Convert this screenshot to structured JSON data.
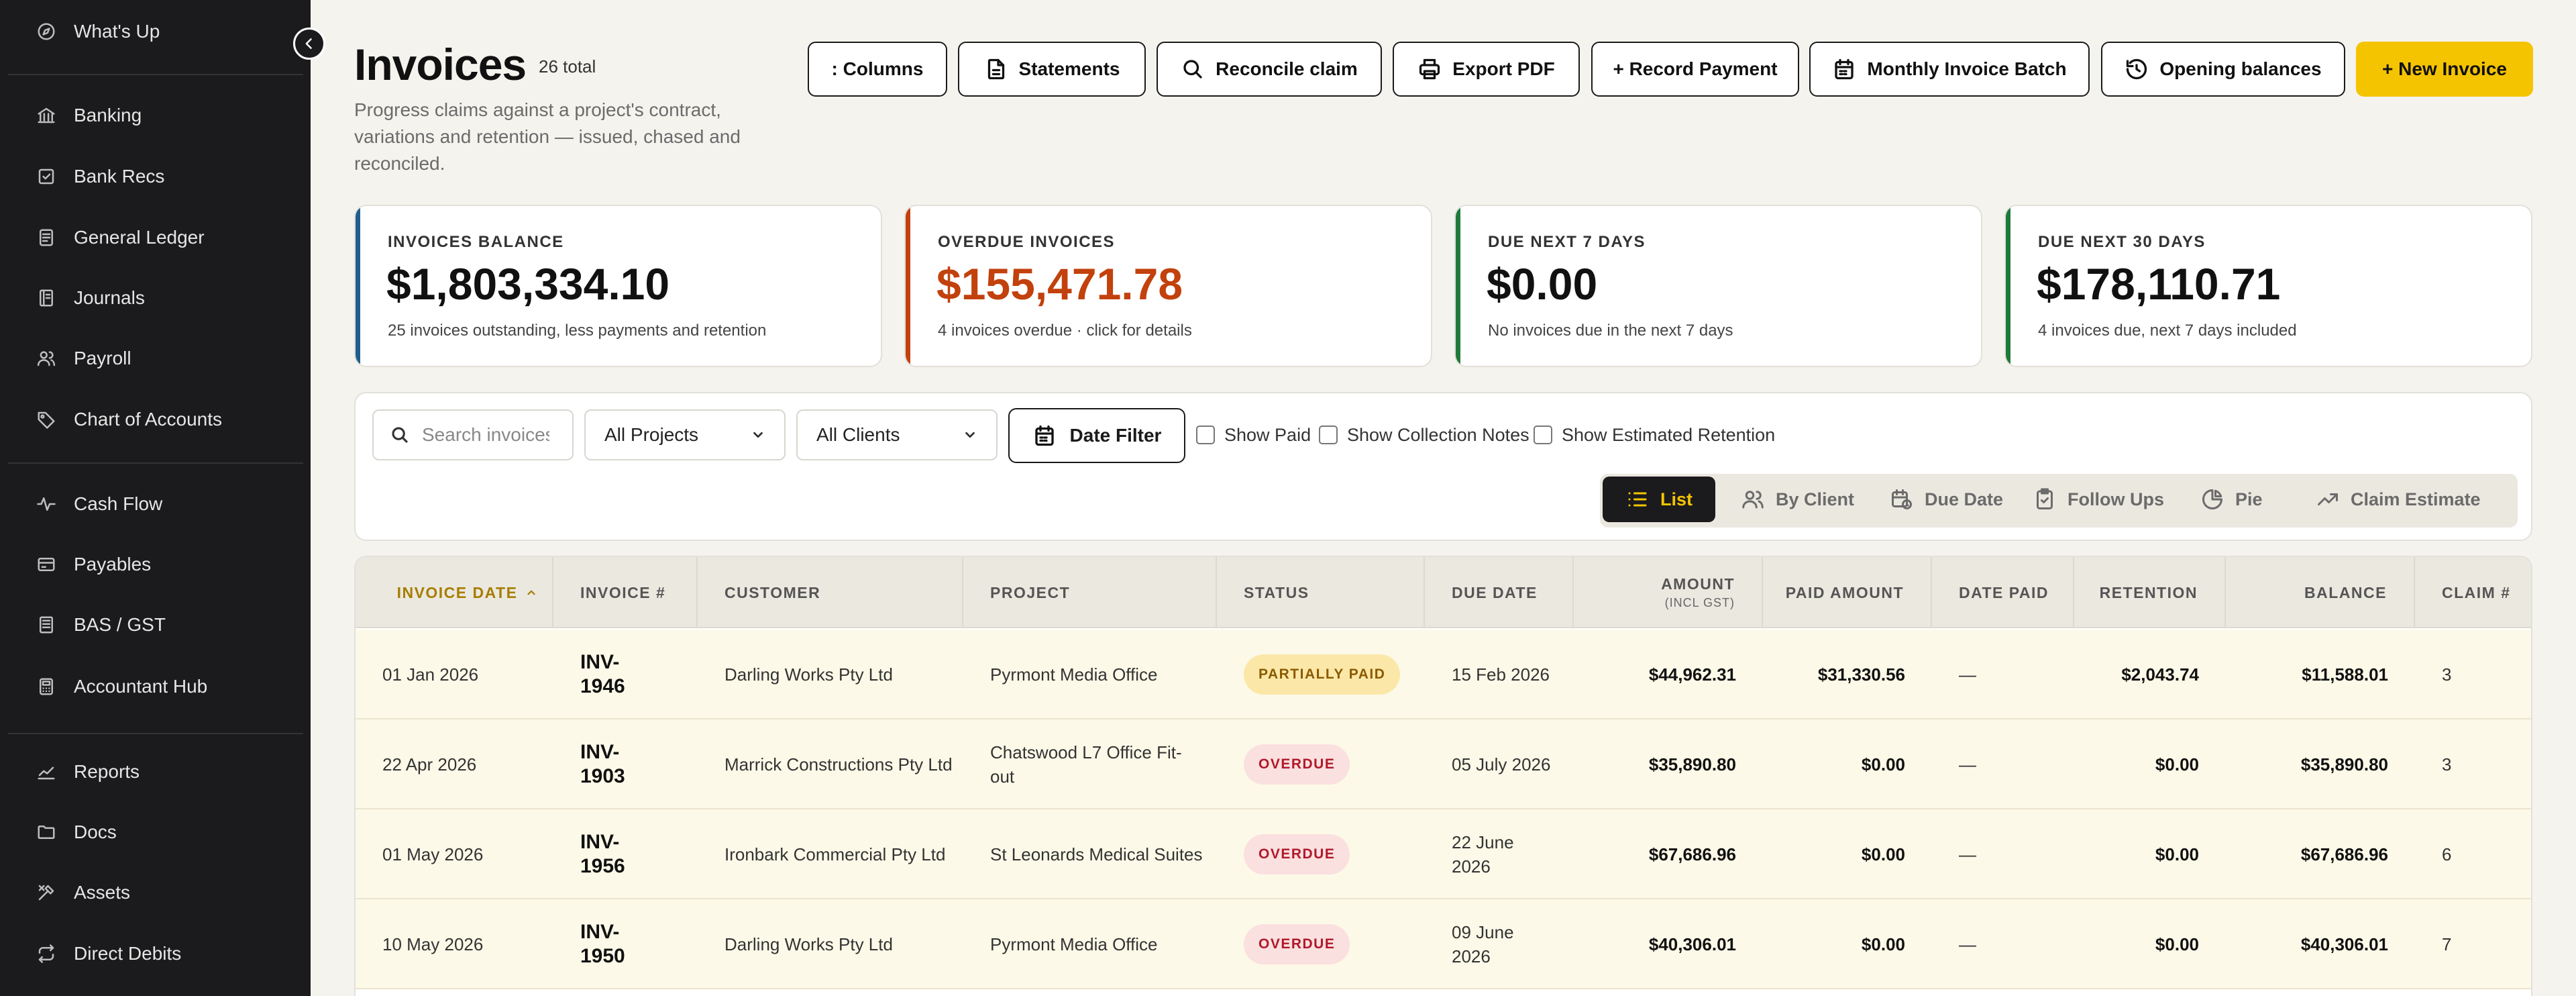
{
  "sidebar": {
    "items": [
      {
        "label": "What's Up",
        "icon": "compass-icon"
      },
      {
        "label": "Banking",
        "icon": "bank-icon"
      },
      {
        "label": "Bank Recs",
        "icon": "check-square-icon"
      },
      {
        "label": "General Ledger",
        "icon": "ledger-icon"
      },
      {
        "label": "Journals",
        "icon": "journal-icon"
      },
      {
        "label": "Payroll",
        "icon": "users-icon"
      },
      {
        "label": "Chart of Accounts",
        "icon": "tag-icon"
      },
      {
        "label": "Cash Flow",
        "icon": "pulse-icon"
      },
      {
        "label": "Payables",
        "icon": "card-icon"
      },
      {
        "label": "BAS / GST",
        "icon": "receipt-icon"
      },
      {
        "label": "Accountant Hub",
        "icon": "calculator-icon"
      },
      {
        "label": "Reports",
        "icon": "chart-icon"
      },
      {
        "label": "Docs",
        "icon": "folder-icon"
      },
      {
        "label": "Assets",
        "icon": "tools-icon"
      },
      {
        "label": "Direct Debits",
        "icon": "repeat-icon"
      }
    ]
  },
  "header": {
    "title": "Invoices",
    "total": "26 total",
    "subtitle": "Progress claims against a project's contract, variations and retention — issued, chased and reconciled."
  },
  "toolbar": {
    "columns": ": Columns",
    "statements": "Statements",
    "reconcile": "Reconcile claim",
    "export_pdf": "Export PDF",
    "record_payment": "+ Record Payment",
    "monthly_batch": "Monthly Invoice Batch",
    "opening_balances": "Opening balances",
    "new_invoice": "+ New Invoice"
  },
  "kpis": [
    {
      "label": "INVOICES BALANCE",
      "value": "$1,803,334.10",
      "note": "25 invoices outstanding, less payments and retention",
      "accent": "#1f5e8c",
      "value_color": "#111111"
    },
    {
      "label": "OVERDUE INVOICES",
      "value": "$155,471.78",
      "note": "4 invoices overdue · click for details",
      "accent": "#c2410c",
      "value_color": "#c2410c"
    },
    {
      "label": "DUE NEXT 7 DAYS",
      "value": "$0.00",
      "note": "No invoices due in the next 7 days",
      "accent": "#1f7a3a",
      "value_color": "#111111"
    },
    {
      "label": "DUE NEXT 30 DAYS",
      "value": "$178,110.71",
      "note": "4 invoices due, next 7 days included",
      "accent": "#1f7a3a",
      "value_color": "#111111"
    }
  ],
  "filters": {
    "search_placeholder": "Search invoices",
    "projects": "All Projects",
    "clients": "All Clients",
    "date_filter": "Date Filter",
    "show_paid": "Show Paid",
    "show_collection_notes": "Show Collection Notes",
    "show_estimated_retention": "Show Estimated Retention"
  },
  "views": {
    "list": "List",
    "by_client": "By Client",
    "due_date": "Due Date",
    "follow_ups": "Follow Ups",
    "pie": "Pie",
    "claim_estimate": "Claim Estimate"
  },
  "table": {
    "headers": {
      "invoice_date": "INVOICE DATE",
      "invoice_no": "INVOICE #",
      "customer": "CUSTOMER",
      "project": "PROJECT",
      "status": "STATUS",
      "due_date": "DUE DATE",
      "amount": "AMOUNT",
      "amount_sub": "(INCL GST)",
      "paid_amount": "PAID AMOUNT",
      "date_paid": "DATE PAID",
      "retention": "RETENTION",
      "balance": "BALANCE",
      "claim_no": "CLAIM #"
    },
    "rows": [
      {
        "invoice_date": "01 Jan 2026",
        "invoice_no": "INV-1946",
        "customer": "Darling Works Pty Ltd",
        "project": "Pyrmont Media Office",
        "status": "PARTIALLY PAID",
        "due_date": "15 Feb 2026",
        "amount": "$44,962.31",
        "paid_amount": "$31,330.56",
        "date_paid": "—",
        "retention": "$2,043.74",
        "balance": "$11,588.01",
        "claim_no": "3"
      },
      {
        "invoice_date": "22 Apr 2026",
        "invoice_no": "INV-1903",
        "customer": "Marrick Constructions Pty Ltd",
        "project": "Chatswood L7 Office Fit-out",
        "status": "OVERDUE",
        "due_date": "05 July 2026",
        "amount": "$35,890.80",
        "paid_amount": "$0.00",
        "date_paid": "—",
        "retention": "$0.00",
        "balance": "$35,890.80",
        "claim_no": "3"
      },
      {
        "invoice_date": "01 May 2026",
        "invoice_no": "INV-1956",
        "customer": "Ironbark Commercial Pty Ltd",
        "project": "St Leonards Medical Suites",
        "status": "OVERDUE",
        "due_date": "22 June 2026",
        "amount": "$67,686.96",
        "paid_amount": "$0.00",
        "date_paid": "—",
        "retention": "$0.00",
        "balance": "$67,686.96",
        "claim_no": "6"
      },
      {
        "invoice_date": "10 May 2026",
        "invoice_no": "INV-1950",
        "customer": "Darling Works Pty Ltd",
        "project": "Pyrmont Media Office",
        "status": "OVERDUE",
        "due_date": "09 June 2026",
        "amount": "$40,306.01",
        "paid_amount": "$0.00",
        "date_paid": "—",
        "retention": "$0.00",
        "balance": "$40,306.01",
        "claim_no": "7"
      }
    ]
  }
}
